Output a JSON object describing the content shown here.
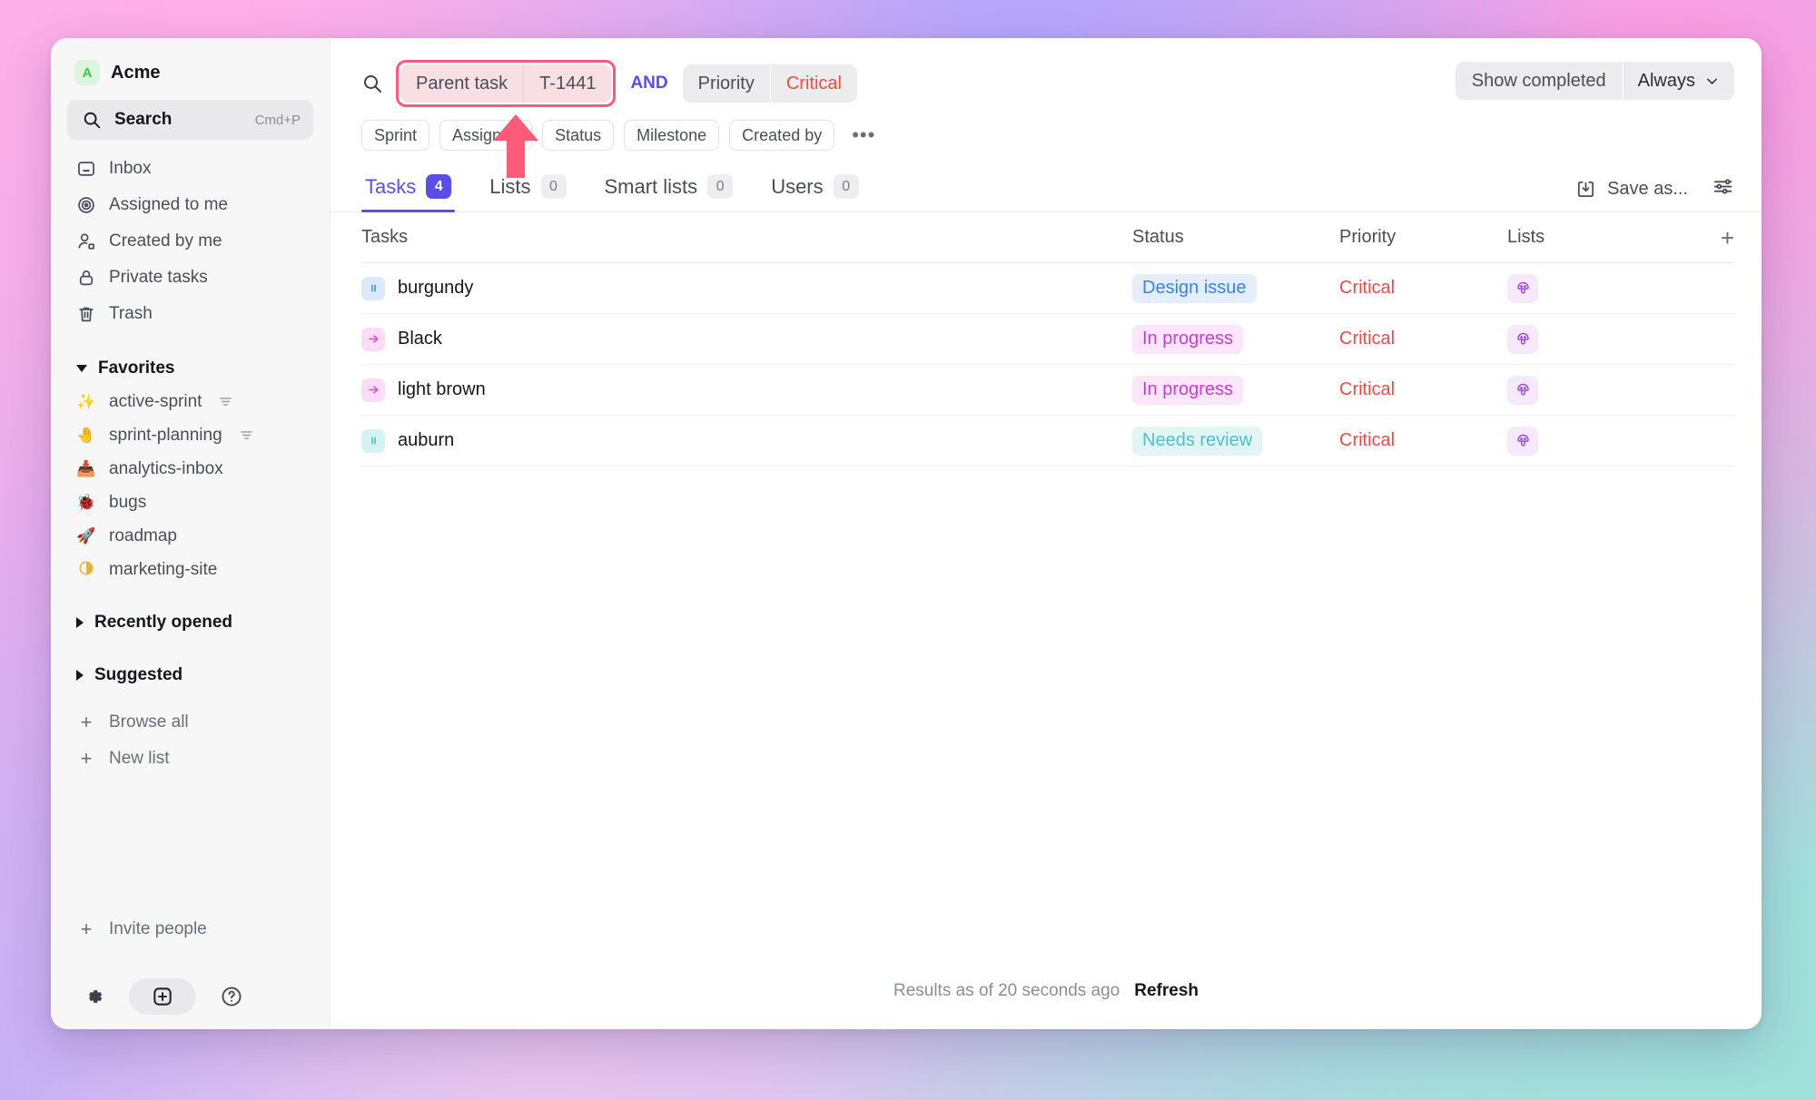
{
  "workspace": {
    "initial": "A",
    "name": "Acme"
  },
  "search": {
    "label": "Search",
    "shortcut": "Cmd+P",
    "icon": "search-icon"
  },
  "nav": [
    {
      "label": "Inbox",
      "icon": "inbox-icon"
    },
    {
      "label": "Assigned to me",
      "icon": "target-icon"
    },
    {
      "label": "Created by me",
      "icon": "user-edit-icon"
    },
    {
      "label": "Private tasks",
      "icon": "lock-icon"
    },
    {
      "label": "Trash",
      "icon": "trash-icon"
    }
  ],
  "favorites": {
    "title": "Favorites",
    "expanded": true,
    "items": [
      {
        "label": "active-sprint",
        "emoji": "✨",
        "icon": "sparkles-icon",
        "has_filter": true
      },
      {
        "label": "sprint-planning",
        "emoji": "🤚",
        "icon": "raised-hand-icon",
        "has_filter": true
      },
      {
        "label": "analytics-inbox",
        "emoji": "📥",
        "icon": "inbox-tray-icon",
        "has_filter": false
      },
      {
        "label": "bugs",
        "emoji": "🐞",
        "icon": "bug-icon",
        "has_filter": false
      },
      {
        "label": "roadmap",
        "emoji": "🚀",
        "icon": "rocket-icon",
        "has_filter": false
      },
      {
        "label": "marketing-site",
        "emoji": "◑",
        "icon": "half-circle-icon",
        "has_filter": false
      }
    ]
  },
  "collapsed_sections": [
    {
      "label": "Recently opened"
    },
    {
      "label": "Suggested"
    }
  ],
  "sidebar_actions": [
    {
      "label": "Browse all",
      "icon": "plus-icon"
    },
    {
      "label": "New list",
      "icon": "plus-icon"
    }
  ],
  "invite": {
    "label": "Invite people",
    "icon": "plus-icon"
  },
  "bottom_bar": [
    {
      "name": "settings-button",
      "icon": "gear-icon"
    },
    {
      "name": "new-item-button",
      "icon": "plus-square-icon"
    },
    {
      "name": "help-button",
      "icon": "help-circle-icon"
    }
  ],
  "query": {
    "search_icon": "search-icon",
    "filters": [
      {
        "key": "Parent task",
        "value": "T-1441",
        "highlighted": true,
        "value_style": "normal"
      },
      {
        "key": "Priority",
        "value": "Critical",
        "highlighted": false,
        "value_style": "critical"
      }
    ],
    "operator": "AND"
  },
  "filter_pills": {
    "items": [
      "Sprint",
      "Assignee",
      "Status",
      "Milestone",
      "Created by"
    ],
    "more": "•••"
  },
  "show_completed": {
    "label": "Show completed",
    "value": "Always",
    "chevron": "chevron-down-icon"
  },
  "tabs": [
    {
      "label": "Tasks",
      "count": "4",
      "active": true
    },
    {
      "label": "Lists",
      "count": "0",
      "active": false
    },
    {
      "label": "Smart lists",
      "count": "0",
      "active": false
    },
    {
      "label": "Users",
      "count": "0",
      "active": false
    }
  ],
  "tabs_right": {
    "save_as": "Save as...",
    "save_icon": "save-download-icon",
    "settings_icon": "sliders-icon"
  },
  "table": {
    "columns": [
      "Tasks",
      "Status",
      "Priority",
      "Lists"
    ],
    "add_column": "+",
    "rows": [
      {
        "name": "burgundy",
        "icon": "pause-icon",
        "icon_tone": "blue",
        "status": "Design issue",
        "status_tone": "blue",
        "priority": "Critical",
        "priority_tone": "critical",
        "list_icon": "mushroom-icon"
      },
      {
        "name": "Black",
        "icon": "arrow-right-icon",
        "icon_tone": "pink",
        "status": "In progress",
        "status_tone": "pink",
        "priority": "Critical",
        "priority_tone": "critical",
        "list_icon": "mushroom-icon"
      },
      {
        "name": "light brown",
        "icon": "arrow-right-icon",
        "icon_tone": "pink",
        "status": "In progress",
        "status_tone": "pink",
        "priority": "Critical",
        "priority_tone": "critical",
        "list_icon": "mushroom-icon"
      },
      {
        "name": "auburn",
        "icon": "pause-icon",
        "icon_tone": "teal",
        "status": "Needs review",
        "status_tone": "teal",
        "priority": "Critical",
        "priority_tone": "critical",
        "list_icon": "mushroom-icon"
      }
    ]
  },
  "footer": {
    "text": "Results as of 20 seconds ago",
    "refresh": "Refresh"
  },
  "annotation": {
    "type": "arrow-up",
    "color": "#ff5a7a",
    "points_at": "parent-task-filter-chip"
  },
  "colors": {
    "accent": "#5b4de8",
    "critical": "#f04a45",
    "highlight_border": "#ff5a7a",
    "highlight_fill": "#f7dfe4"
  }
}
